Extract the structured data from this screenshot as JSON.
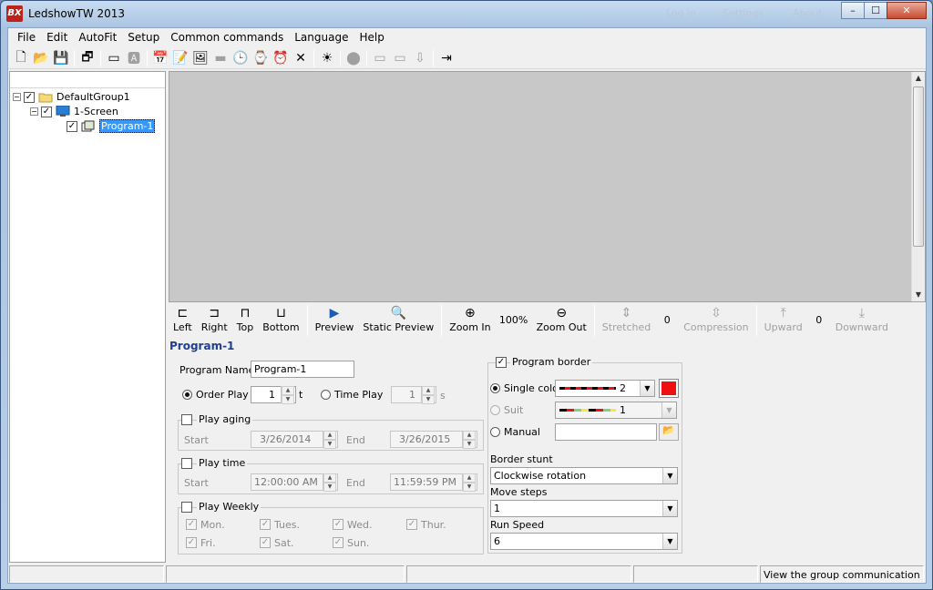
{
  "window": {
    "logo": "BX",
    "title": "LedshowTW 2013",
    "ghost_links": [
      "Log in",
      "Settings",
      "About"
    ],
    "caption": {
      "minimize": "–",
      "maximize": "☐",
      "close": "✕"
    }
  },
  "menu": [
    "File",
    "Edit",
    "AutoFit",
    "Setup",
    "Common commands",
    "Language",
    "Help"
  ],
  "toolbar_icons": [
    {
      "name": "new-file-icon",
      "glyph": "🗋",
      "enabled": true
    },
    {
      "name": "open-folder-icon",
      "glyph": "📂",
      "enabled": true
    },
    {
      "name": "save-icon",
      "glyph": "💾",
      "enabled": true
    },
    {
      "sep": true
    },
    {
      "name": "program-icon",
      "glyph": "🗗",
      "enabled": true
    },
    {
      "sep": true
    },
    {
      "name": "area-icon",
      "glyph": "▭",
      "enabled": true
    },
    {
      "name": "text-area-icon",
      "glyph": "🅰",
      "enabled": false
    },
    {
      "sep": true
    },
    {
      "name": "calendar-icon",
      "glyph": "📅",
      "enabled": true
    },
    {
      "name": "edit-text-icon",
      "glyph": "📝",
      "enabled": false
    },
    {
      "name": "image-icon",
      "glyph": "🖼",
      "enabled": true
    },
    {
      "name": "video-icon",
      "glyph": "▬",
      "enabled": false
    },
    {
      "name": "clock-icon",
      "glyph": "🕒",
      "enabled": true
    },
    {
      "name": "digital-clock-icon",
      "glyph": "⌚",
      "enabled": true
    },
    {
      "name": "alarm-icon",
      "glyph": "⏰",
      "enabled": true
    },
    {
      "name": "delete-icon",
      "glyph": "✕",
      "enabled": true
    },
    {
      "sep": true
    },
    {
      "name": "brightness-icon",
      "glyph": "☀",
      "enabled": true
    },
    {
      "sep": true
    },
    {
      "name": "stop-icon",
      "glyph": "⬤",
      "enabled": false
    },
    {
      "sep": true
    },
    {
      "name": "send-icon",
      "glyph": "▭",
      "enabled": false
    },
    {
      "name": "send-all-icon",
      "glyph": "▭",
      "enabled": false
    },
    {
      "name": "usb-icon",
      "glyph": "⇩",
      "enabled": false
    },
    {
      "sep": true
    },
    {
      "name": "exit-icon",
      "glyph": "⇥",
      "enabled": true
    }
  ],
  "tree": {
    "group": "DefaultGroup1",
    "screen": "1-Screen",
    "program": "Program-1"
  },
  "preview_toolbar": {
    "left": "Left",
    "right": "Right",
    "top": "Top",
    "bottom": "Bottom",
    "preview": "Preview",
    "static_preview": "Static Preview",
    "zoom_in": "Zoom In",
    "zoom_value": "100%",
    "zoom_out": "Zoom Out",
    "stretched": "Stretched",
    "stretch_value": "0",
    "compression": "Compression",
    "upward": "Upward",
    "move_value": "0",
    "downward": "Downward"
  },
  "panel": {
    "title": "Program-1",
    "program_name_label": "Program Name",
    "program_name": "Program-1",
    "order_play_label": "Order Play",
    "order_play_value": "1",
    "order_play_unit": "t",
    "time_play_label": "Time Play",
    "time_play_value": "1",
    "time_play_unit": "s",
    "play_aging_label": "Play aging",
    "aging_start_label": "Start",
    "aging_start": "3/26/2014",
    "aging_end_label": "End",
    "aging_end": "3/26/2015",
    "play_time_label": "Play time",
    "time_start_label": "Start",
    "time_start": "12:00:00 AM",
    "time_end_label": "End",
    "time_end": "11:59:59 PM",
    "play_weekly_label": "Play Weekly",
    "weekdays": [
      "Mon.",
      "Tues.",
      "Wed.",
      "Thur.",
      "Fri.",
      "Sat.",
      "Sun."
    ]
  },
  "border": {
    "program_border_label": "Program border",
    "single_color_label": "Single color",
    "single_color_value": "2",
    "suit_label": "Suit",
    "suit_value": "1",
    "manual_label": "Manual",
    "accent_color": "#ee1111",
    "border_stunt_label": "Border stunt",
    "border_stunt": "Clockwise rotation",
    "move_steps_label": "Move steps",
    "move_steps": "1",
    "run_speed_label": "Run Speed",
    "run_speed": "6"
  },
  "status": {
    "message": "View the group communication status"
  }
}
